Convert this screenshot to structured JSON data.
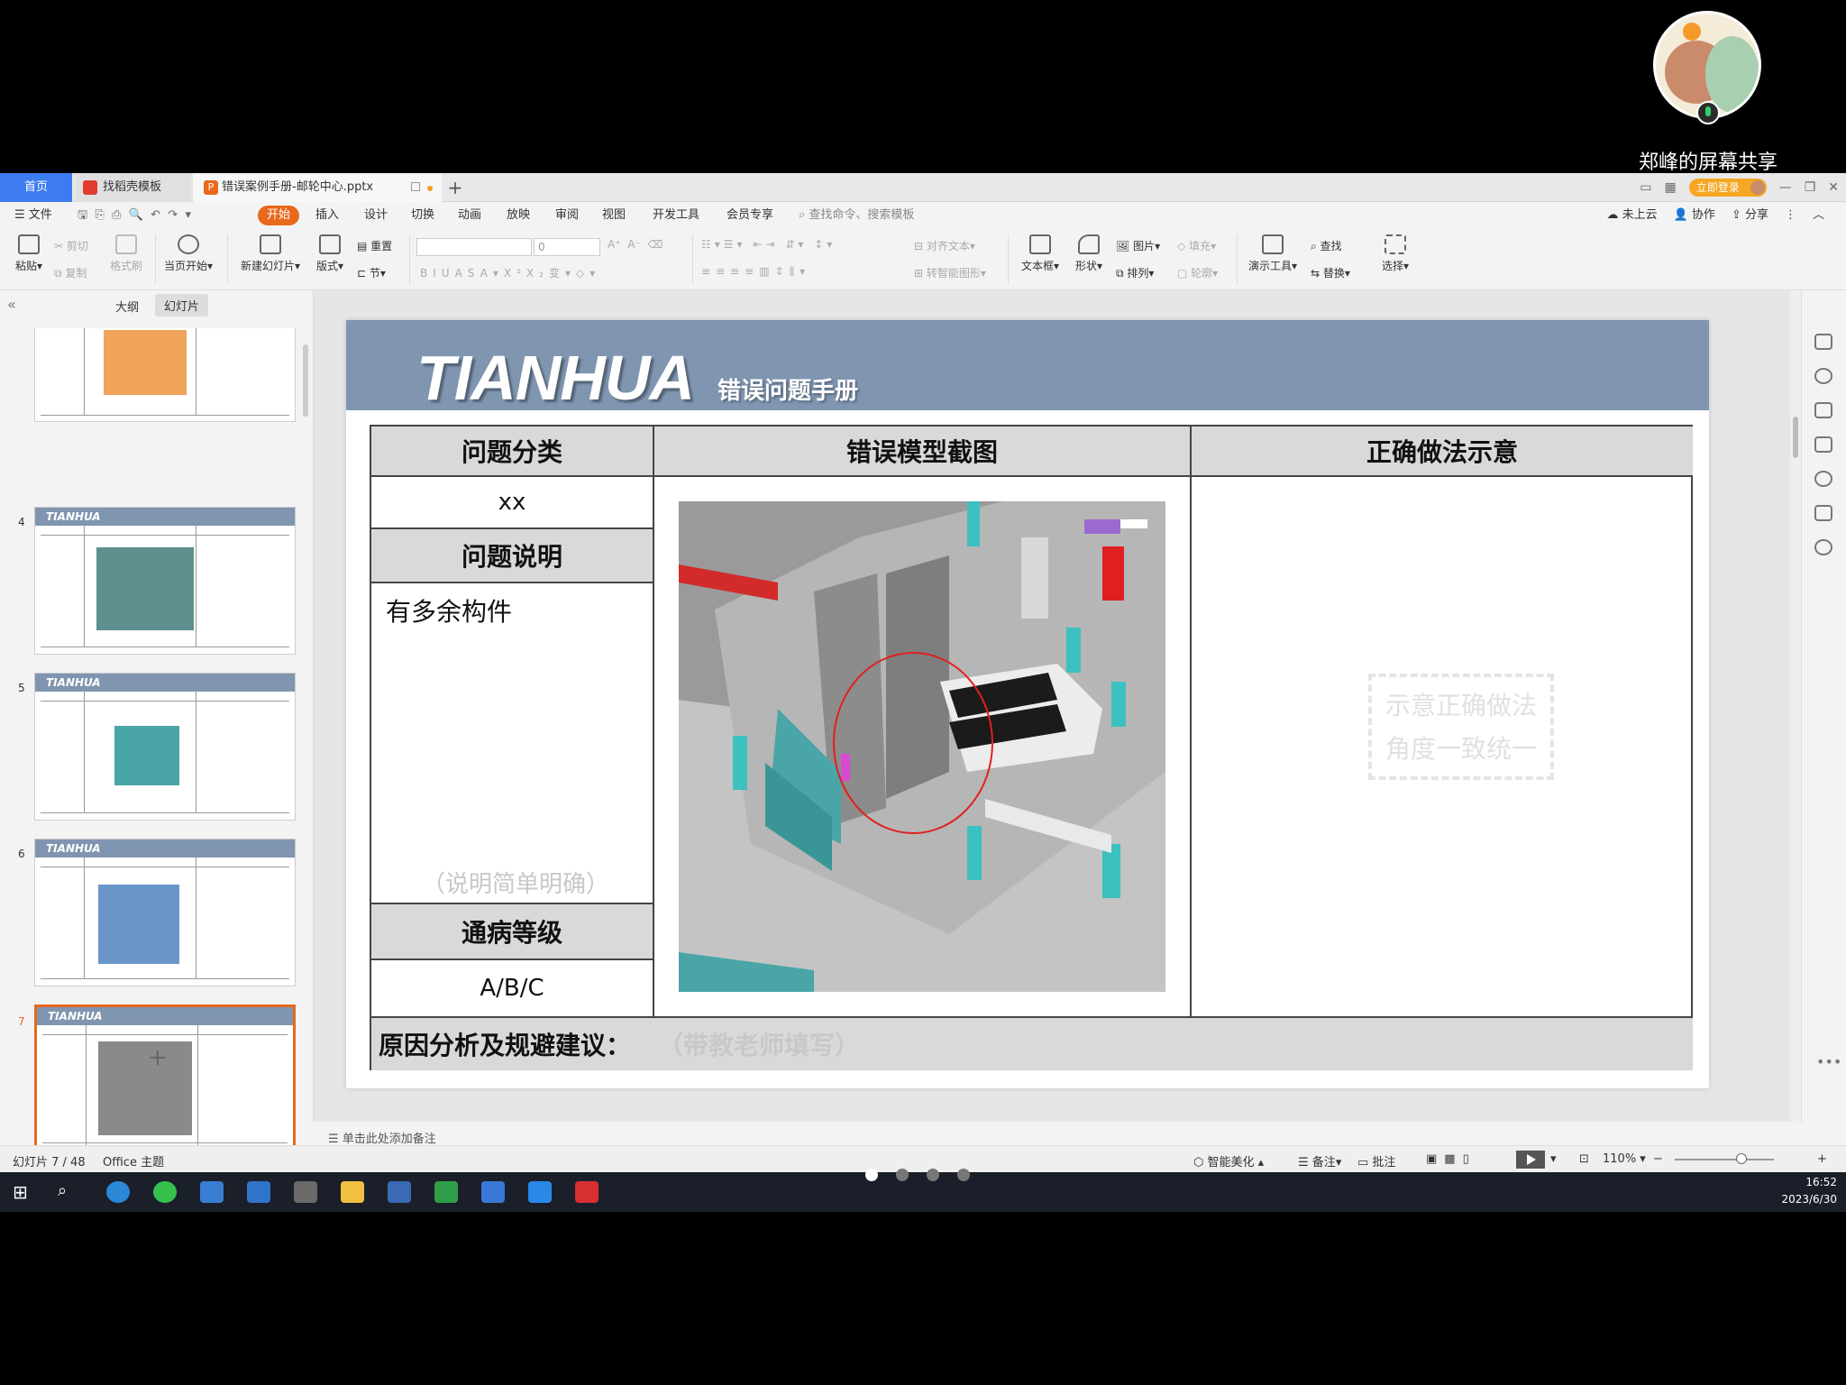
{
  "share": {
    "label": "郑峰的屏幕共享"
  },
  "tabs": {
    "home": "首页",
    "templates": "找稻壳模板",
    "document": "错误案例手册-邮轮中心.pptx",
    "new_tab": "+",
    "login": "立即登录"
  },
  "menu": {
    "file": "文件",
    "start": "开始",
    "items": [
      "插入",
      "设计",
      "切换",
      "动画",
      "放映",
      "审阅",
      "视图",
      "开发工具",
      "会员专享"
    ],
    "search": "查找命令、搜索模板",
    "cloud": "未上云",
    "collab": "协作",
    "share": "分享"
  },
  "ribbon": {
    "paste": "粘贴",
    "cut": "剪切",
    "copy": "复制",
    "format_painter": "格式刷",
    "from_current": "当页开始",
    "new_slide": "新建幻灯片",
    "layout": "版式",
    "reset": "重置",
    "section": "节",
    "font_size": "0",
    "align_text": "对齐文本",
    "smart_shape": "转智能图形",
    "textbox": "文本框",
    "shape": "形状",
    "picture": "图片",
    "arrange": "排列",
    "fill": "填充",
    "outline": "轮廓",
    "presenter_tools": "演示工具",
    "find": "查找",
    "replace": "替换",
    "select": "选择"
  },
  "left_panel": {
    "outline_tab": "大纲",
    "slides_tab": "幻灯片",
    "add": "+",
    "thumbs": [
      {
        "num": "",
        "brand": ""
      },
      {
        "num": "4",
        "brand": "TIANHUA"
      },
      {
        "num": "5",
        "brand": "TIANHUA"
      },
      {
        "num": "6",
        "brand": "TIANHUA"
      },
      {
        "num": "7",
        "brand": "TIANHUA"
      }
    ]
  },
  "slide": {
    "brand": "TIANHUA",
    "title": "错误问题手册",
    "headers": {
      "category": "问题分类",
      "error_shot": "错误模型截图",
      "correct": "正确做法示意"
    },
    "category_value": "xx",
    "desc_header": "问题说明",
    "desc_value": "有多余构件",
    "desc_hint": "（说明简单明确）",
    "level_header": "通病等级",
    "level_value": "A/B/C",
    "cause_label": "原因分析及规避建议：",
    "cause_hint": "（带教老师填写）",
    "ok_placeholder_1": "示意正确做法",
    "ok_placeholder_2": "角度一致统一"
  },
  "notes": {
    "placeholder": "单击此处添加备注"
  },
  "status": {
    "slide_counter": "幻灯片 7 / 48",
    "theme": "Office 主题",
    "beautify": "智能美化",
    "notes": "备注",
    "comments": "批注",
    "zoom": "110%"
  },
  "clock": {
    "time": "16:52",
    "date": "2023/6/30"
  }
}
